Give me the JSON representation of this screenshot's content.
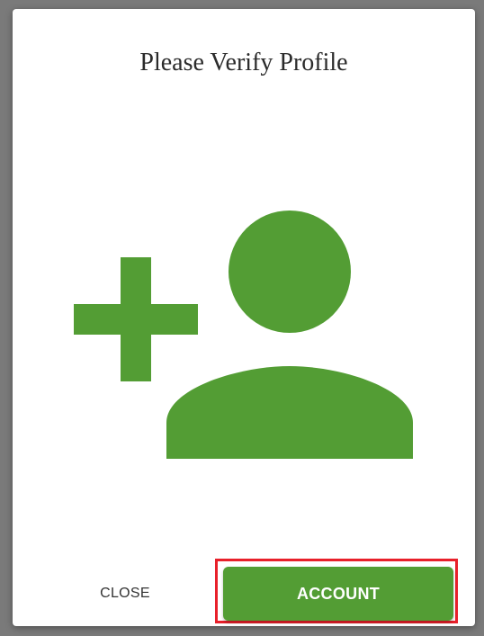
{
  "dialog": {
    "title": "Please Verify Profile",
    "icon": "add-user-icon",
    "icon_color": "#539d34",
    "buttons": {
      "close_label": "CLOSE",
      "account_label": "ACCOUNT"
    },
    "accent_color": "#539d34",
    "highlight_color": "#e8202a"
  }
}
